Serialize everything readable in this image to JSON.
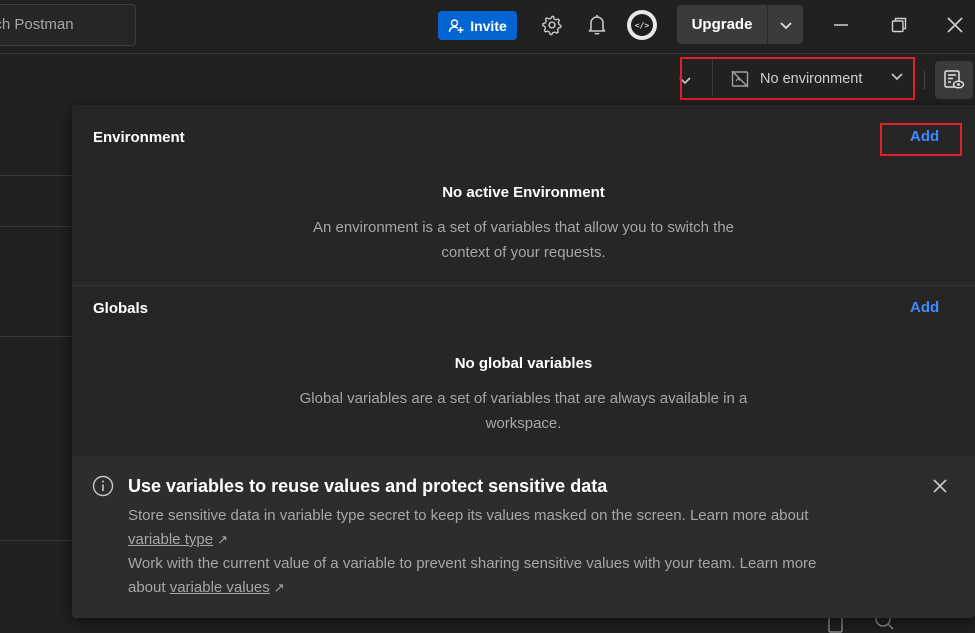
{
  "topbar": {
    "search_placeholder": "arch Postman",
    "invite_label": "Invite",
    "upgrade_label": "Upgrade"
  },
  "environment_selector": {
    "selected": "No environment"
  },
  "popup": {
    "environment": {
      "title": "Environment",
      "add_label": "Add",
      "empty_title": "No active Environment",
      "empty_desc_line1": "An environment is a set of variables that allow you to switch the",
      "empty_desc_line2": "context of your requests."
    },
    "globals": {
      "title": "Globals",
      "add_label": "Add",
      "empty_title": "No global variables",
      "empty_desc_line1": "Global variables are a set of variables that are always available in a",
      "empty_desc_line2": "workspace."
    },
    "info": {
      "title": "Use variables to reuse values and protect sensitive data",
      "line1": "Store sensitive data in variable type secret to keep its values masked on the screen. Learn more about",
      "link1": "variable type",
      "line2": "Work with the current value of a variable to prevent sharing sensitive values with your team. Learn more",
      "line2_prefix": "about",
      "link2": "variable values"
    }
  },
  "colors": {
    "background": "#212121",
    "accent_blue": "#0265d2",
    "link_blue": "#3d8bfd",
    "highlight_red": "#e0202a"
  }
}
